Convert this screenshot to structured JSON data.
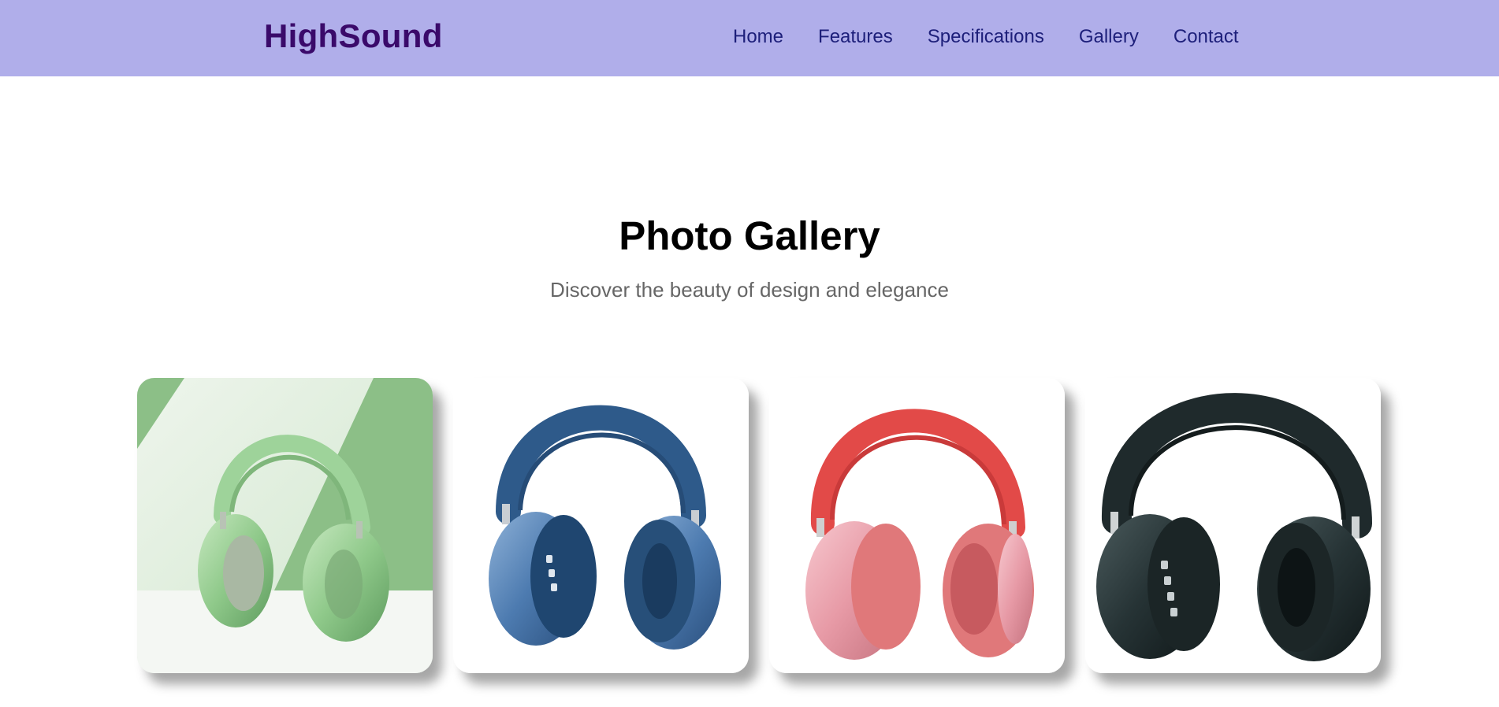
{
  "header": {
    "brand": "HighSound",
    "nav": [
      "Home",
      "Features",
      "Specifications",
      "Gallery",
      "Contact"
    ]
  },
  "gallery": {
    "title": "Photo Gallery",
    "subtitle": "Discover the beauty of design and elegance",
    "items": [
      {
        "icon": "green-headphones-photo",
        "color": "#9ed39a"
      },
      {
        "icon": "blue-headphones-photo",
        "color": "#2e5a8a"
      },
      {
        "icon": "pink-headphones-photo",
        "color": "#e0787a"
      },
      {
        "icon": "black-headphones-photo",
        "color": "#1f2a2c"
      }
    ]
  },
  "colors": {
    "header_bg": "#b0aeea",
    "brand": "#3a0a6a",
    "nav_link": "#1d1f7a"
  }
}
